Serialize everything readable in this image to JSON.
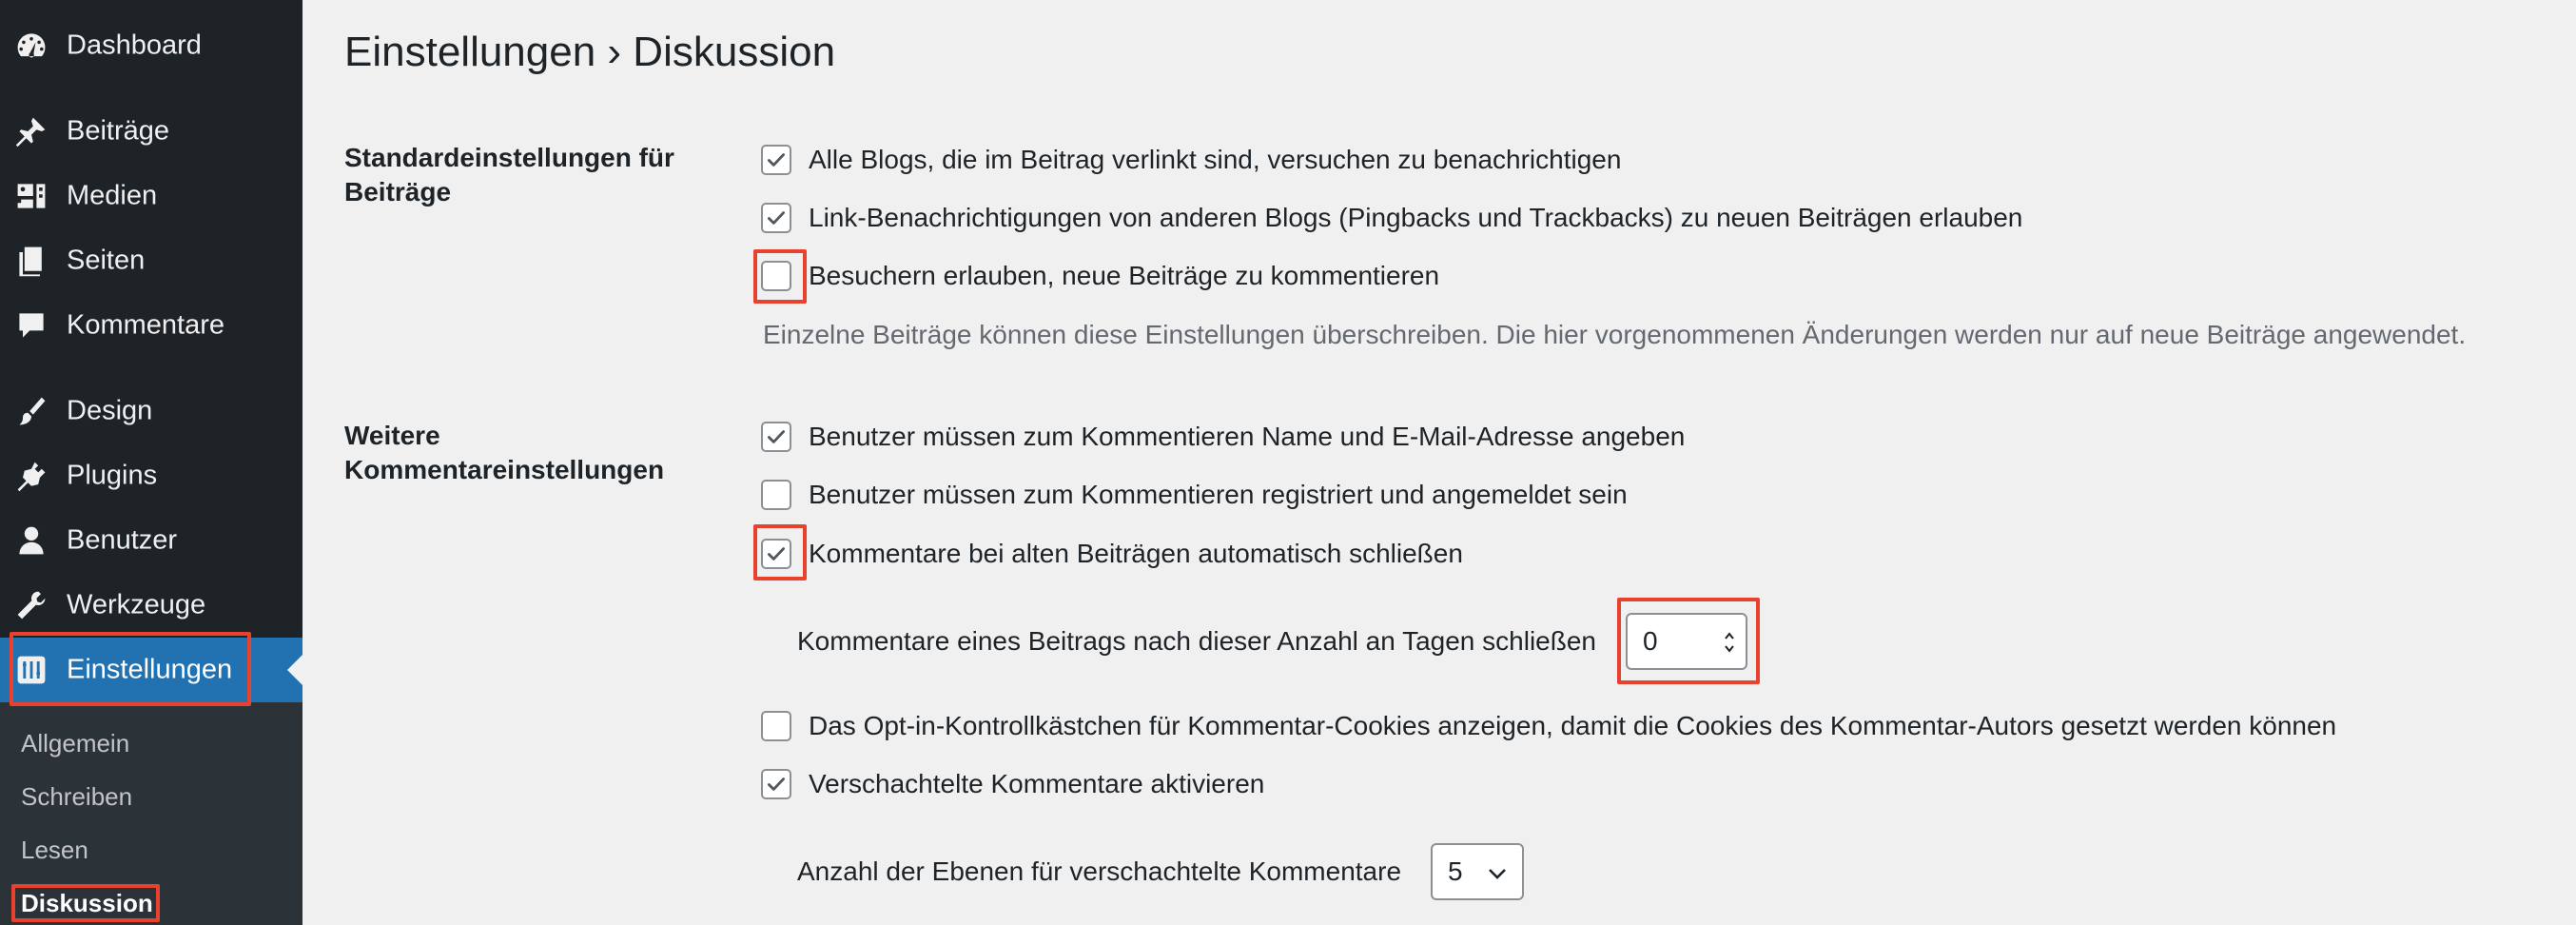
{
  "sidebar": {
    "items": [
      {
        "label": "Dashboard",
        "icon": "dashboard-icon"
      },
      {
        "label": "Beiträge",
        "icon": "pin-icon"
      },
      {
        "label": "Medien",
        "icon": "media-icon"
      },
      {
        "label": "Seiten",
        "icon": "pages-icon"
      },
      {
        "label": "Kommentare",
        "icon": "comments-icon"
      },
      {
        "label": "Design",
        "icon": "brush-icon"
      },
      {
        "label": "Plugins",
        "icon": "plugin-icon"
      },
      {
        "label": "Benutzer",
        "icon": "user-icon"
      },
      {
        "label": "Werkzeuge",
        "icon": "wrench-icon"
      },
      {
        "label": "Einstellungen",
        "icon": "settings-icon"
      }
    ],
    "submenu": [
      "Allgemein",
      "Schreiben",
      "Lesen",
      "Diskussion"
    ]
  },
  "page": {
    "title": "Einstellungen › Diskussion"
  },
  "sections": {
    "default_post": {
      "label": "Standardeinstellungen für Beiträge",
      "options": [
        {
          "label": "Alle Blogs, die im Beitrag verlinkt sind, versuchen zu benachrichtigen",
          "checked": true
        },
        {
          "label": "Link-Benachrichtigungen von anderen Blogs (Pingbacks und Trackbacks) zu neuen Beiträgen erlauben",
          "checked": true
        },
        {
          "label": "Besuchern erlauben, neue Beiträge zu kommentieren",
          "checked": false
        }
      ],
      "description": "Einzelne Beiträge können diese Einstellungen überschreiben. Die hier vorgenommenen Änderungen werden nur auf neue Beiträge angewendet."
    },
    "other_comment": {
      "label": "Weitere Kommentareinstellungen",
      "options": [
        {
          "label": "Benutzer müssen zum Kommentieren Name und E-Mail-Adresse angeben",
          "checked": true
        },
        {
          "label": "Benutzer müssen zum Kommentieren registriert und angemeldet sein",
          "checked": false
        },
        {
          "label": "Kommentare bei alten Beiträgen automatisch schließen",
          "checked": true
        },
        {
          "label": "Das Opt-in-Kontrollkästchen für Kommentar-Cookies anzeigen, damit die Cookies des Kommentar-Autors gesetzt werden können",
          "checked": false
        },
        {
          "label": "Verschachtelte Kommentare aktivieren",
          "checked": true
        }
      ],
      "close_days_label": "Kommentare eines Beitrags nach dieser Anzahl an Tagen schließen",
      "close_days_value": "0",
      "thread_depth_label": "Anzahl der Ebenen für verschachtelte Kommentare",
      "thread_depth_value": "5"
    }
  },
  "colors": {
    "sidebar_bg": "#1d2327",
    "active_bg": "#2271b1",
    "highlight": "#e8412e"
  }
}
